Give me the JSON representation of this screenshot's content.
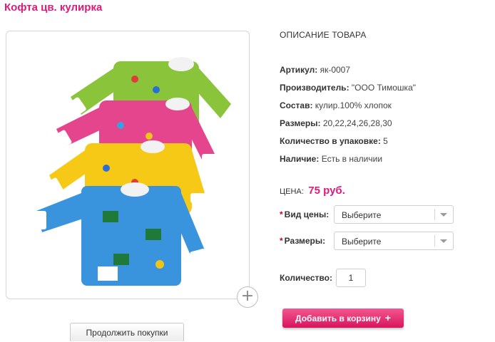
{
  "product": {
    "title": "Кофта цв. кулирка"
  },
  "gallery": {
    "zoom_icon": "+",
    "continue_label": "Продолжить покупки"
  },
  "description": {
    "heading": "ОПИСАНИЕ ТОВАРА",
    "props": [
      {
        "label": "Артикул:",
        "value": "як-0007"
      },
      {
        "label": "Производитель:",
        "value": "\"ООО Тимошка\""
      },
      {
        "label": "Состав:",
        "value": "кулир.100% хлопок"
      },
      {
        "label": "Размеры:",
        "value": "20,22,24,26,28,30"
      },
      {
        "label": "Количество в упаковке:",
        "value": "5"
      },
      {
        "label": "Наличие:",
        "value": "Есть в наличии"
      }
    ]
  },
  "price": {
    "label": "ЦЕНА:",
    "value": "75 руб."
  },
  "options": [
    {
      "required_mark": "*",
      "label": "Вид цены:",
      "selected": "Выберите"
    },
    {
      "required_mark": "*",
      "label": "Размеры:",
      "selected": "Выберите"
    }
  ],
  "quantity": {
    "label": "Количество:",
    "value": "1"
  },
  "cart": {
    "label": "Добавить в корзину",
    "plus": "+"
  },
  "colors": {
    "accent": "#e0197a",
    "required": "#d0021b"
  },
  "icons": {
    "zoom": "plus-icon",
    "select_arrow": "chevron-down-icon"
  }
}
